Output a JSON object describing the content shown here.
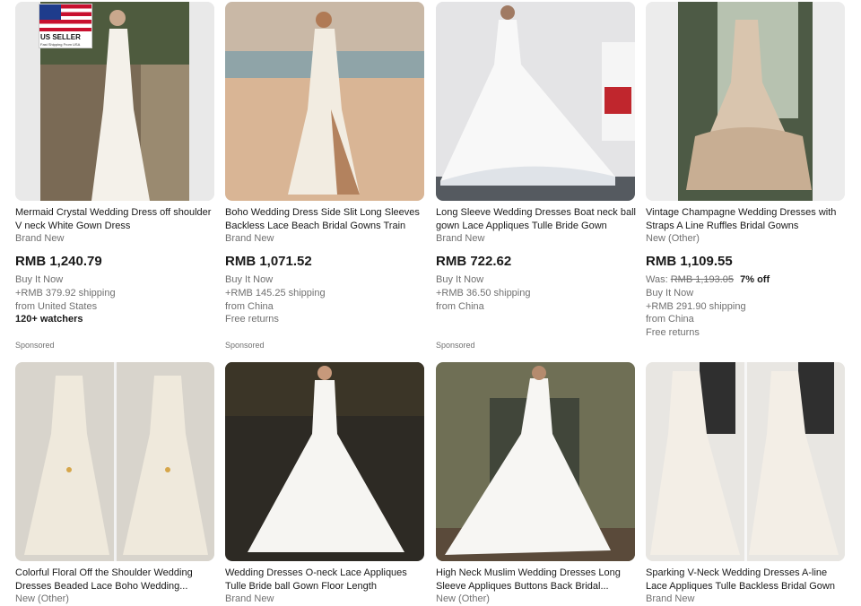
{
  "listings_row1": [
    {
      "title": "Mermaid Crystal Wedding Dress off shoulder V neck White Gown Dress",
      "condition": "Brand New",
      "price": "RMB 1,240.79",
      "format": "Buy It Now",
      "shipping": "+RMB 379.92 shipping",
      "location": "from United States",
      "watchers": "120+ watchers",
      "badge": {
        "label": "US SELLER",
        "sub": "Fast Shipping From USA"
      },
      "sponsored": "Sponsored"
    },
    {
      "title": "Boho Wedding Dress Side Slit Long Sleeves Backless Lace Beach Bridal Gowns Train",
      "condition": "Brand New",
      "price": "RMB 1,071.52",
      "format": "Buy It Now",
      "shipping": "+RMB 145.25 shipping",
      "location": "from China",
      "returns": "Free returns",
      "sponsored": "Sponsored"
    },
    {
      "title": "Long Sleeve Wedding Dresses Boat neck ball gown Lace Appliques Tulle Bride Gown",
      "condition": "Brand New",
      "price": "RMB 722.62",
      "format": "Buy It Now",
      "shipping": "+RMB 36.50 shipping",
      "location": "from China",
      "sponsored": "Sponsored"
    },
    {
      "title": "Vintage Champagne Wedding Dresses with Straps A Line Ruffles Bridal Gowns",
      "condition": "New (Other)",
      "price": "RMB 1,109.55",
      "was_label": "Was:",
      "was_price": "RMB 1,193.05",
      "discount": "7% off",
      "format": "Buy It Now",
      "shipping": "+RMB 291.90 shipping",
      "location": "from China",
      "returns": "Free returns"
    }
  ],
  "listings_row2": [
    {
      "title": "Colorful Floral Off the Shoulder Wedding Dresses Beaded Lace Boho Wedding...",
      "condition": "New (Other)"
    },
    {
      "title": "Wedding Dresses O-neck Lace Appliques Tulle Bride ball Gown Floor Length",
      "condition": "Brand New"
    },
    {
      "title": "High Neck Muslim Wedding Dresses Long Sleeve Appliques Buttons Back Bridal...",
      "condition": "New (Other)"
    },
    {
      "title": "Sparking V-Neck Wedding Dresses A-line Lace Appliques Tulle Backless Bridal Gown",
      "condition": "Brand New"
    }
  ],
  "icons": [
    "us-flag-icon"
  ],
  "colors": {
    "text": "#191919",
    "muted": "#707070",
    "image_bg": "#ececec"
  }
}
